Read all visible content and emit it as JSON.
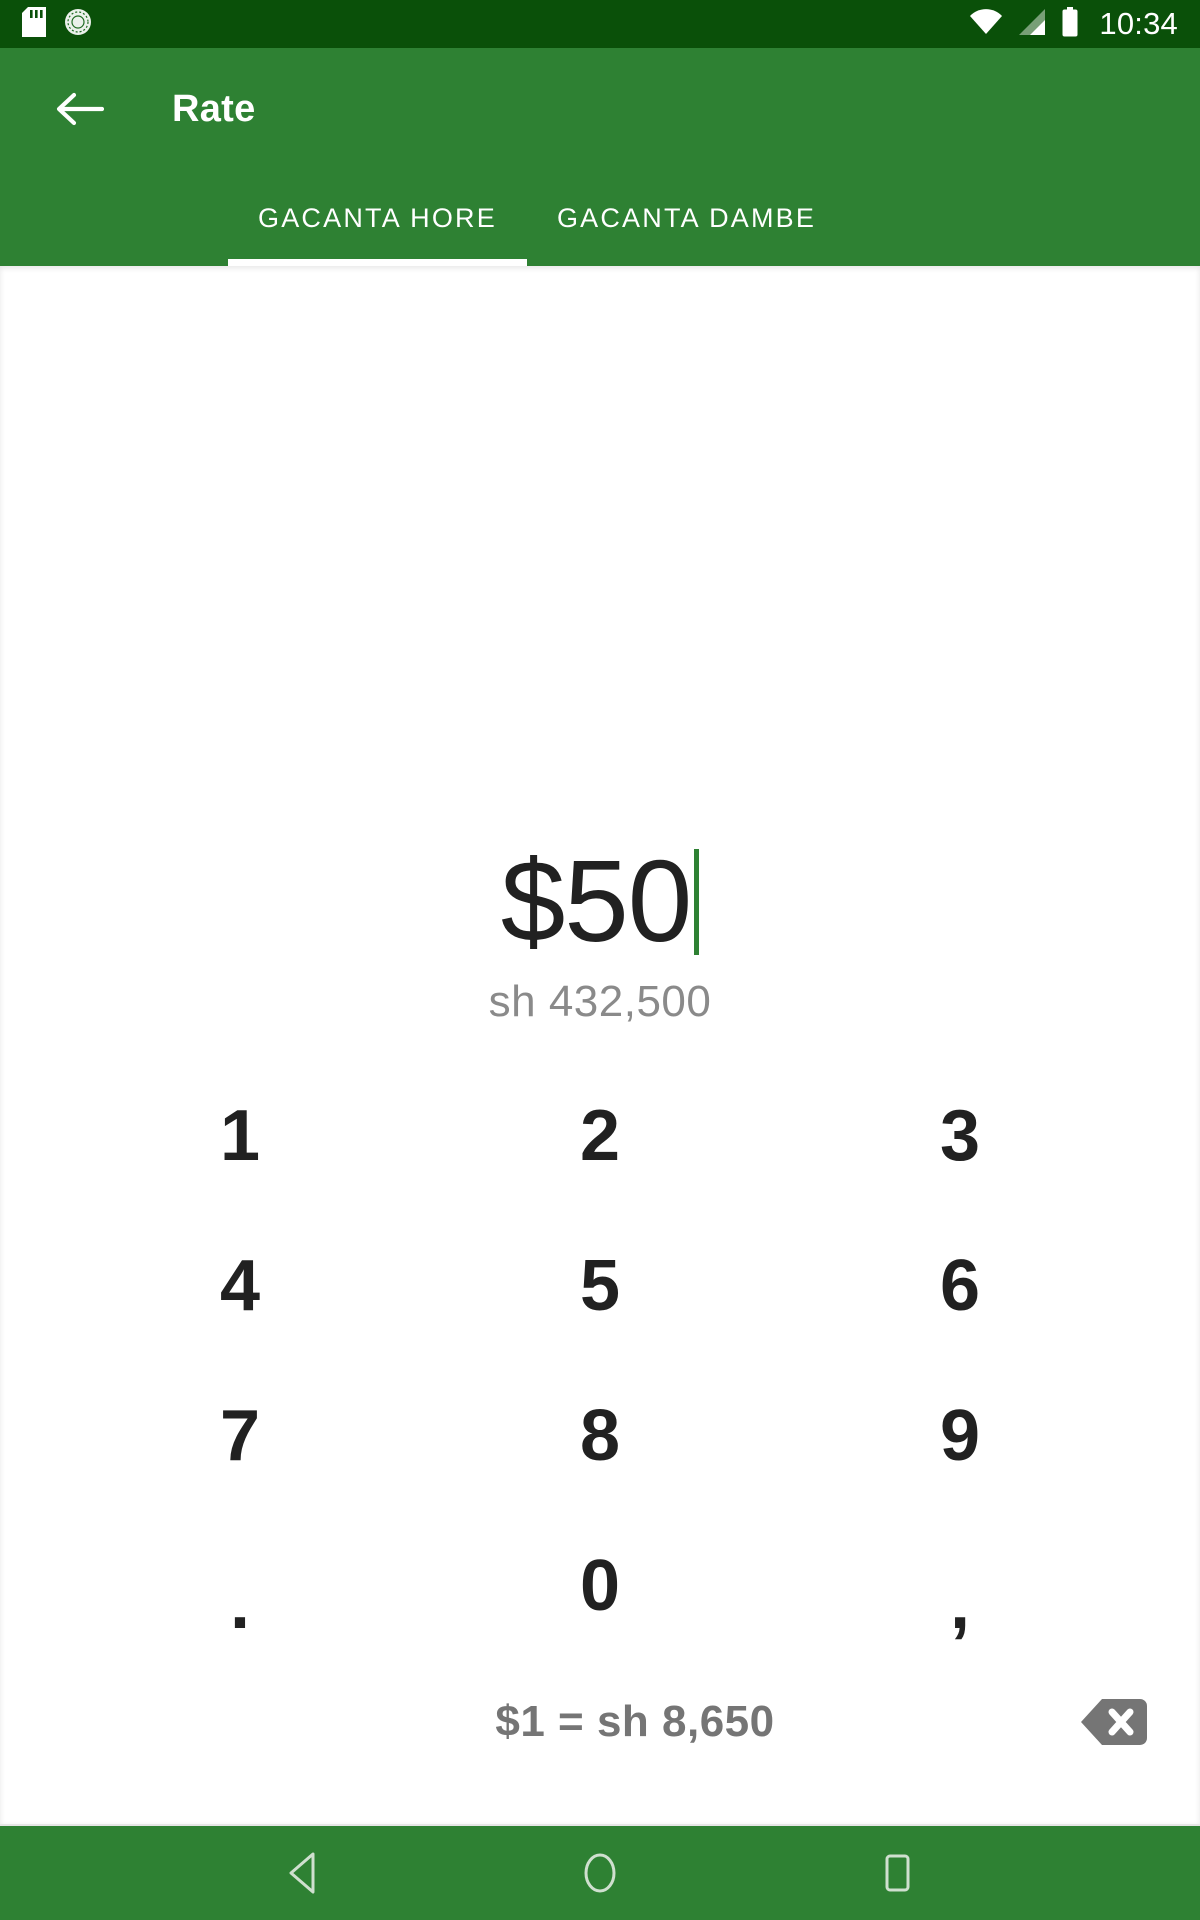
{
  "status_bar": {
    "time": "10:34",
    "icons": [
      "sd-card-icon",
      "sync-icon",
      "wifi-icon",
      "signal-icon",
      "battery-icon"
    ],
    "background": "#0a5009"
  },
  "app_bar": {
    "title": "Rate",
    "back_icon": "arrow-left-icon",
    "background": "#2e8133"
  },
  "tabs": [
    {
      "label": "GACANTA HORE",
      "active": true
    },
    {
      "label": "GACANTA DAMBE",
      "active": false
    }
  ],
  "amount": {
    "value": "$50",
    "converted": "sh 432,500",
    "caret_color": "#2e8133"
  },
  "keypad": {
    "keys": [
      {
        "label": "1",
        "name": "key-1"
      },
      {
        "label": "2",
        "name": "key-2"
      },
      {
        "label": "3",
        "name": "key-3"
      },
      {
        "label": "4",
        "name": "key-4"
      },
      {
        "label": "5",
        "name": "key-5"
      },
      {
        "label": "6",
        "name": "key-6"
      },
      {
        "label": "7",
        "name": "key-7"
      },
      {
        "label": "8",
        "name": "key-8"
      },
      {
        "label": "9",
        "name": "key-9"
      },
      {
        "label": ".",
        "name": "key-decimal"
      },
      {
        "label": "0",
        "name": "key-0"
      },
      {
        "label": ",",
        "name": "key-comma"
      }
    ]
  },
  "footer": {
    "rate_text": "$1 = sh 8,650",
    "backspace_icon": "backspace-icon"
  },
  "nav_bar": {
    "back": "nav-back-icon",
    "home": "nav-home-icon",
    "recents": "nav-recents-icon",
    "background": "#2e8133"
  }
}
